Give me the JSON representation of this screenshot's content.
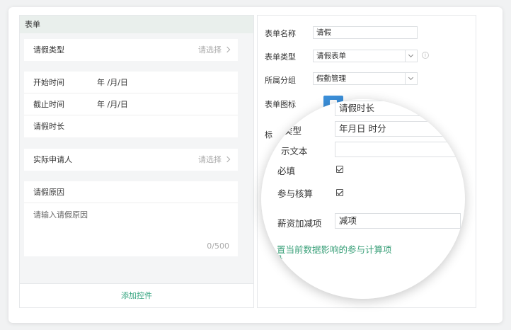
{
  "left": {
    "header": "表单",
    "leave_type": {
      "label": "请假类型",
      "select": "请选择"
    },
    "start_time": {
      "label": "开始时间",
      "value": "年 /月/日"
    },
    "end_time": {
      "label": "截止时间",
      "value": "年 /月/日"
    },
    "duration": {
      "label": "请假时长"
    },
    "applicant": {
      "label": "实际申请人",
      "select": "请选择"
    },
    "reason": {
      "label": "请假原因",
      "placeholder": "请输入请假原因",
      "counter": "0/500"
    },
    "add_control": "添加控件"
  },
  "right": {
    "form_name": {
      "label": "表单名称",
      "value": "请假"
    },
    "form_type": {
      "label": "表单类型",
      "value": "请假表单"
    },
    "group": {
      "label": "所属分组",
      "value": "假勤管理"
    },
    "icon": {
      "label": "表单图标"
    },
    "partial_label": "标"
  },
  "zoom": {
    "title_value": "请假时长",
    "type_label": "类型",
    "type_value": "年月日 时分",
    "hint_label": "示文本",
    "required_label": "必填",
    "calc_label": "参与核算",
    "salary_label": "薪资加减项",
    "salary_value": "减项",
    "link_text": "置当前数据影响的参与计算项",
    "link_text2": "设"
  },
  "colors": {
    "accent": "#36a580",
    "icon_bg": "#3b8fd9"
  }
}
